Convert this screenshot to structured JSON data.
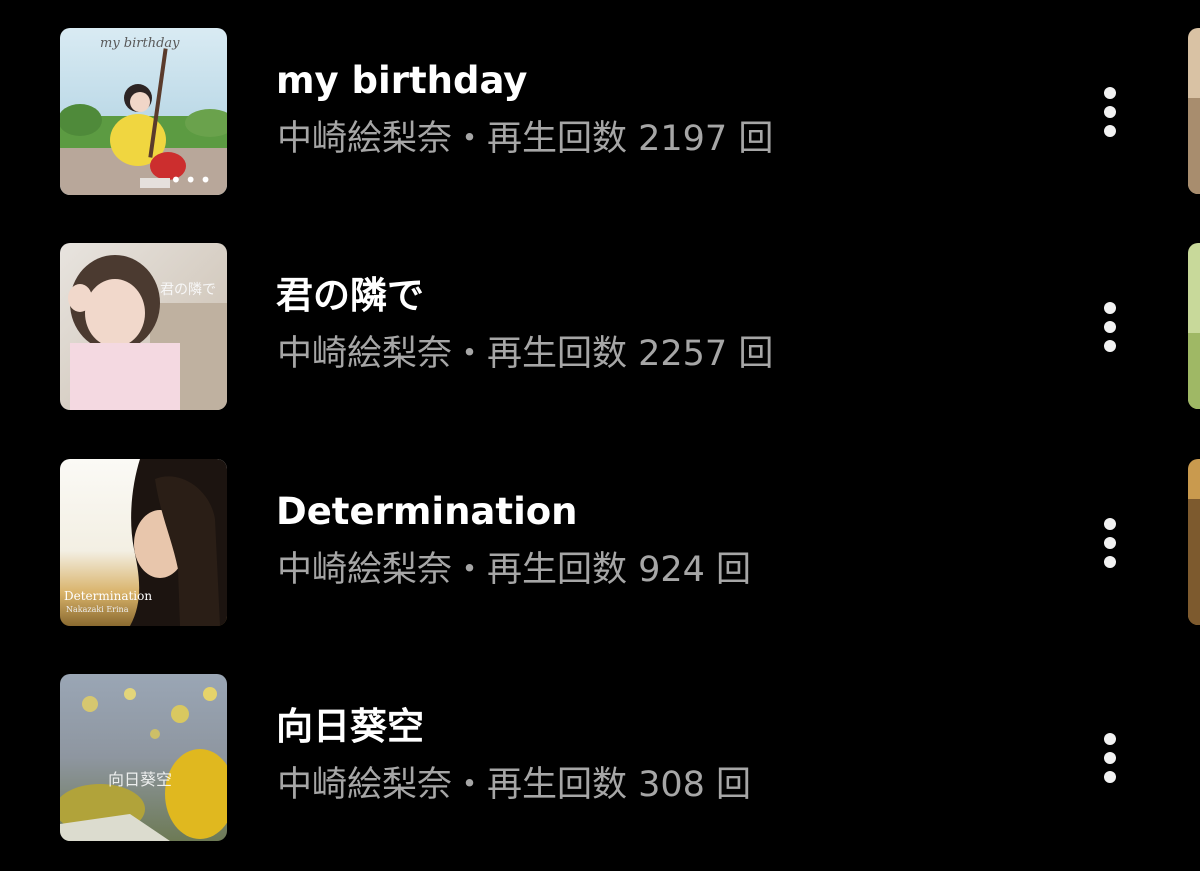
{
  "tracks": [
    {
      "title": "my birthday",
      "subtitle": "中崎絵梨奈・再生回数 2197 回",
      "cover_text": "my birthday",
      "cover_icon": "ellipsis-icon"
    },
    {
      "title": "君の隣で",
      "subtitle": "中崎絵梨奈・再生回数 2257 回",
      "cover_text": "君の隣で"
    },
    {
      "title": "Determination",
      "subtitle": "中崎絵梨奈・再生回数 924 回",
      "cover_text": "Determination",
      "cover_subtext": "Nakazaki Erina"
    },
    {
      "title": "向日葵空",
      "subtitle": "中崎絵梨奈・再生回数 308 回",
      "cover_text": "向日葵空"
    }
  ],
  "icons": {
    "more": "more-vert-icon"
  },
  "colors": {
    "background": "#000000",
    "title": "#ffffff",
    "subtitle": "#a6a6a6"
  }
}
